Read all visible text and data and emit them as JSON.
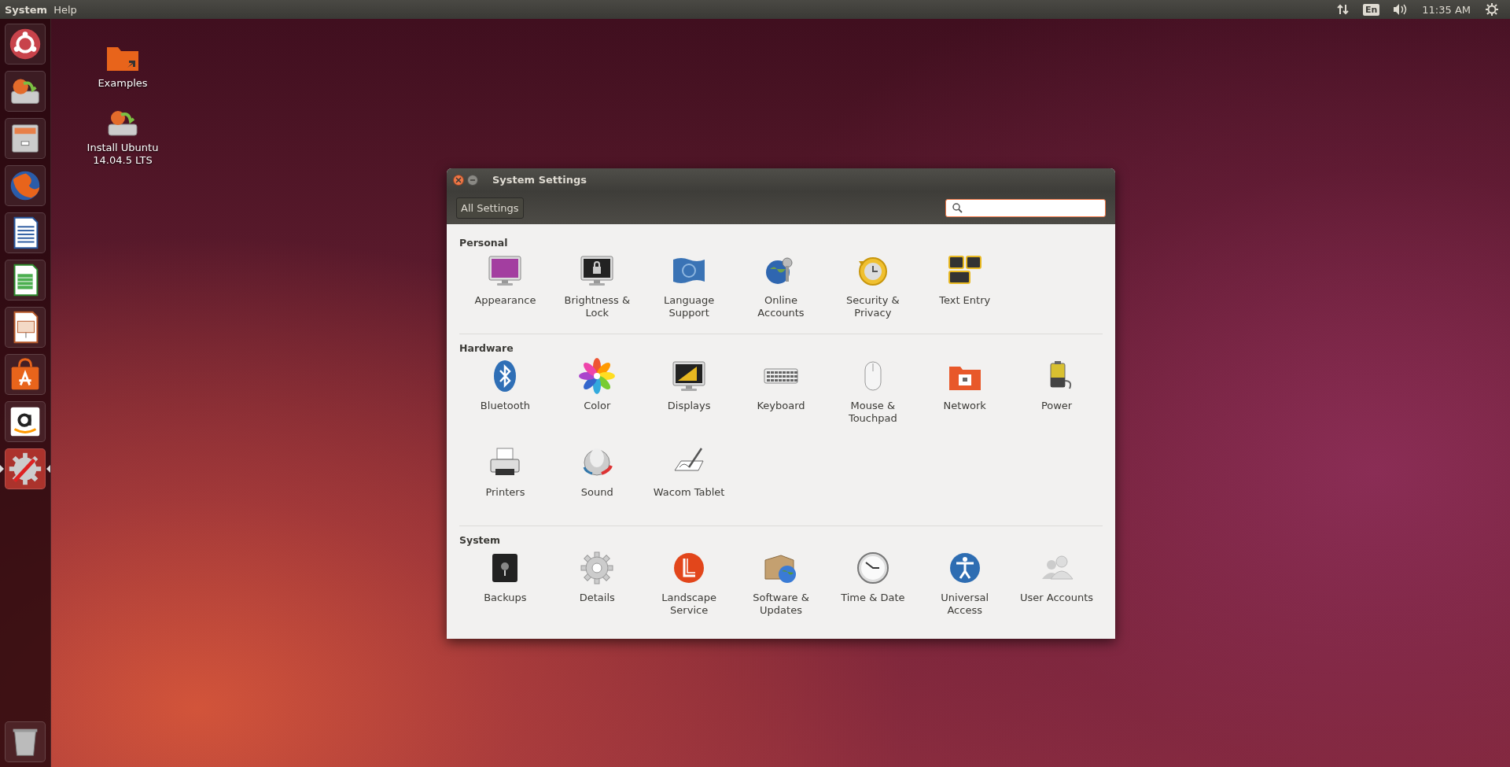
{
  "top_bar": {
    "menus": [
      "System",
      "Help"
    ],
    "keyboard_layout": "En",
    "clock": "11:35 AM"
  },
  "launcher": {
    "items": [
      {
        "active": false
      },
      {
        "active": false
      },
      {
        "active": false
      },
      {
        "active": false
      },
      {
        "active": false
      },
      {
        "active": false
      },
      {
        "active": false
      },
      {
        "active": false
      },
      {
        "active": false
      },
      {
        "active": true
      }
    ]
  },
  "desktop_icons": [
    {
      "label": "Examples"
    },
    {
      "label": "Install Ubuntu 14.04.5 LTS"
    }
  ],
  "window": {
    "title": "System Settings",
    "toolbar": {
      "back_button": "All Settings",
      "search": {
        "focused": true
      }
    },
    "sections": [
      {
        "title": "Personal",
        "items": [
          "Appearance",
          "Brightness & Lock",
          "Language Support",
          "Online Accounts",
          "Security & Privacy",
          "Text Entry"
        ]
      },
      {
        "title": "Hardware",
        "items": [
          "Bluetooth",
          "Color",
          "Displays",
          "Keyboard",
          "Mouse & Touchpad",
          "Network",
          "Power",
          "Printers",
          "Sound",
          "Wacom Tablet"
        ]
      },
      {
        "title": "System",
        "items": [
          "Backups",
          "Details",
          "Landscape Service",
          "Software & Updates",
          "Time & Date",
          "Universal Access",
          "User Accounts"
        ]
      }
    ]
  }
}
